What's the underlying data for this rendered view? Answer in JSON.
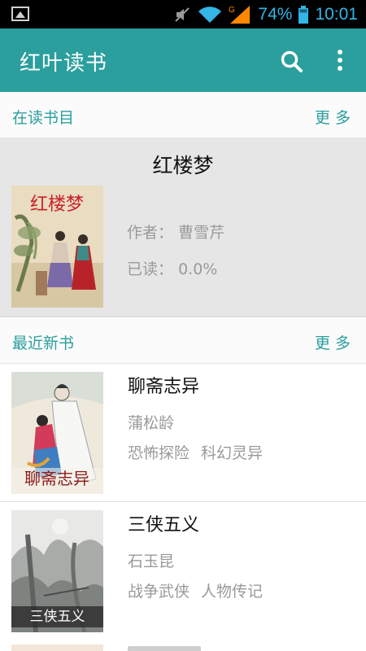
{
  "status_bar": {
    "battery_percent": "74%",
    "time": "10:01",
    "network_label": "G"
  },
  "app_bar": {
    "title": "红叶读书",
    "accent_color": "#2a9f9d"
  },
  "reading_section": {
    "label": "在读书目",
    "more": "更多",
    "book": {
      "title": "红楼梦",
      "cover_text": "红楼梦",
      "author_label": "作者：",
      "author": "曹雪芹",
      "read_label": "已读：",
      "read_value": "0.0%"
    }
  },
  "new_section": {
    "label": "最近新书",
    "more": "更多",
    "books": [
      {
        "title": "聊斋志异",
        "cover_text": "聊斋志异",
        "author": "蒲松龄",
        "tags": [
          "恐怖探险",
          "科幻灵异"
        ]
      },
      {
        "title": "三侠五义",
        "cover_text": "三侠五义",
        "author": "石玉昆",
        "tags": [
          "战争武侠",
          "人物传记"
        ]
      }
    ]
  }
}
